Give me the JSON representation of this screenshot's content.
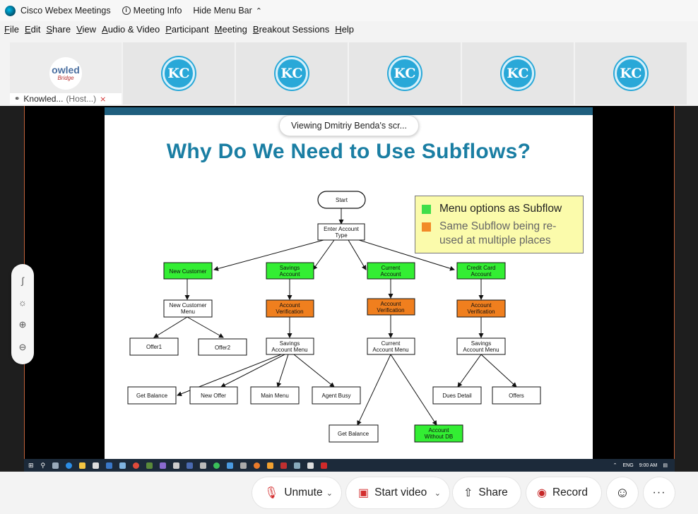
{
  "titlebar": {
    "app_name": "Cisco Webex Meetings",
    "meeting_info": "Meeting Info",
    "hide_menu": "Hide Menu Bar"
  },
  "menu": [
    "File",
    "Edit",
    "Share",
    "View",
    "Audio & Video",
    "Participant",
    "Meeting",
    "Breakout Sessions",
    "Help"
  ],
  "participants": {
    "host_logo_top": "owled",
    "host_logo_bottom": "Bridge",
    "host_name": "Knowled...",
    "host_role": "(Host...)",
    "tile_initials": "KC"
  },
  "viewing_banner": "Viewing Dmitriy Benda's scr...",
  "slide": {
    "title": "Why Do We Need to Use Subflows?",
    "legend": [
      {
        "label": "Menu options as Subflow",
        "color": "#3fde4a"
      },
      {
        "label": "Same Subflow being re-used at multiple places",
        "color": "#f28a28"
      }
    ],
    "colors": {
      "green": "#33ee33",
      "orange": "#f07f1e",
      "white": "#ffffff"
    },
    "nodes": {
      "start": "Start",
      "enter1": "Enter Account",
      "enter2": "Type",
      "new_customer": "New Customer",
      "savings1": "Savings",
      "savings2": "Account",
      "current1": "Current",
      "current2": "Account",
      "credit1": "Credit Card",
      "credit2": "Account",
      "ncm1": "New Customer",
      "ncm2": "Menu",
      "av1": "Account",
      "av2": "Verification",
      "offer1": "Offer1",
      "offer2": "Offer2",
      "sam1": "Savings",
      "sam2": "Account Menu",
      "cam1": "Current",
      "cam2": "Account Menu",
      "get_balance": "Get Balance",
      "new_offer": "New Offer",
      "main_menu": "Main Menu",
      "agent_busy": "Agent Busy",
      "dues_detail": "Dues Detail",
      "offers": "Offers",
      "awdb1": "Account",
      "awdb2": "Without DB"
    }
  },
  "taskbar": {
    "lang": "ENG",
    "time": "9:00 AM"
  },
  "left_tools": [
    "annotate-icon",
    "pointer-icon",
    "zoom-in-icon",
    "zoom-out-icon"
  ],
  "controls": {
    "unmute": "Unmute",
    "start_video": "Start video",
    "share": "Share",
    "record": "Record",
    "more": "···",
    "reactions_icon": "☺"
  }
}
